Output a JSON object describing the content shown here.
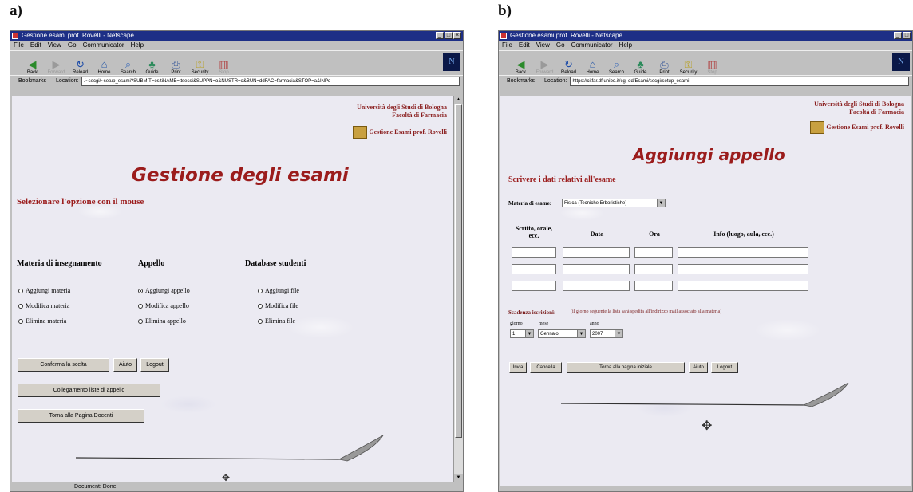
{
  "panel_a": {
    "label": "a)",
    "window_title": "Gestione esami prof. Rovelli - Netscape",
    "menu": [
      "File",
      "Edit",
      "View",
      "Go",
      "Communicator",
      "Help"
    ],
    "toolbar": [
      "Back",
      "Forward",
      "Reload",
      "Home",
      "Search",
      "Guide",
      "Print",
      "Security",
      "Stop"
    ],
    "bookmarks_label": "Bookmarks",
    "location_label": "Location:",
    "url": "/~secgi/~setup_esami?SUBMIT=esitiNAME=ttsessi&SUPPN=o&NUSTR=o&BUN=ddFAC=farmacia&STOP=a&INPd",
    "uni_line1": "Università degli Studi di Bologna",
    "uni_line2": "Facoltà di Farmacia",
    "uni_line3": "Gestione Esami prof. Rovelli",
    "title": "Gestione degli esami",
    "instruction": "Selezionare l'opzione con il mouse",
    "col_materia": "Materia di insegnamento",
    "col_appello": "Appello",
    "col_database": "Database studenti",
    "materia_options": [
      "Aggiungi materia",
      "Modifica materia",
      "Elimina materia"
    ],
    "appello_options": [
      "Aggiungi appello",
      "Modifica appello",
      "Elimina appello"
    ],
    "database_options": [
      "Aggiungi file",
      "Modifica file",
      "Elimina file"
    ],
    "btn_conferma": "Conferma la scelta",
    "btn_aiuto": "Aiuto",
    "btn_logout": "Logout",
    "btn_collegamento": "Collegamento liste di appello",
    "btn_torna": "Torna alla Pagina Docenti",
    "status": "Document: Done"
  },
  "panel_b": {
    "label": "b)",
    "window_title": "Gestione esami prof. Rovelli - Netscape",
    "menu": [
      "File",
      "Edit",
      "View",
      "Go",
      "Communicator",
      "Help"
    ],
    "toolbar": [
      "Back",
      "Forward",
      "Reload",
      "Home",
      "Search",
      "Guide",
      "Print",
      "Security",
      "Stop"
    ],
    "bookmarks_label": "Bookmarks",
    "location_label": "Location:",
    "url": "https://citfar.df.unibo.it/cgi-dd/Esami/secgi/setup_esami",
    "uni_line1": "Università degli Studi di Bologna",
    "uni_line2": "Facoltà di Farmacia",
    "uni_line3": "Gestione Esami prof. Rovelli",
    "title": "Aggiungi appello",
    "instruction": "Scrivere i dati relativi all'esame",
    "materia_label": "Materia di esame:",
    "materia_value": "Fisica (Tecniche Erboristiche)",
    "col_scritto": "Scritto, orale, ecc.",
    "col_data": "Data",
    "col_ora": "Ora",
    "col_info": "Info (luogo, aula, ecc.)",
    "scadenza_label": "Scadenza iscrizioni:",
    "scadenza_note": "(il giorno seguente la lista sarà spedita all'indirizzo mail associato alla materia)",
    "giorno_label": "giorno",
    "mese_label": "mese",
    "anno_label": "anno",
    "giorno_value": "1",
    "mese_value": "Gennaio",
    "anno_value": "2007",
    "btn_invia": "Invia",
    "btn_cancella": "Cancella",
    "btn_torna": "Torna alla pagina iniziale",
    "btn_aiuto": "Aiuto",
    "btn_logout": "Logout"
  }
}
